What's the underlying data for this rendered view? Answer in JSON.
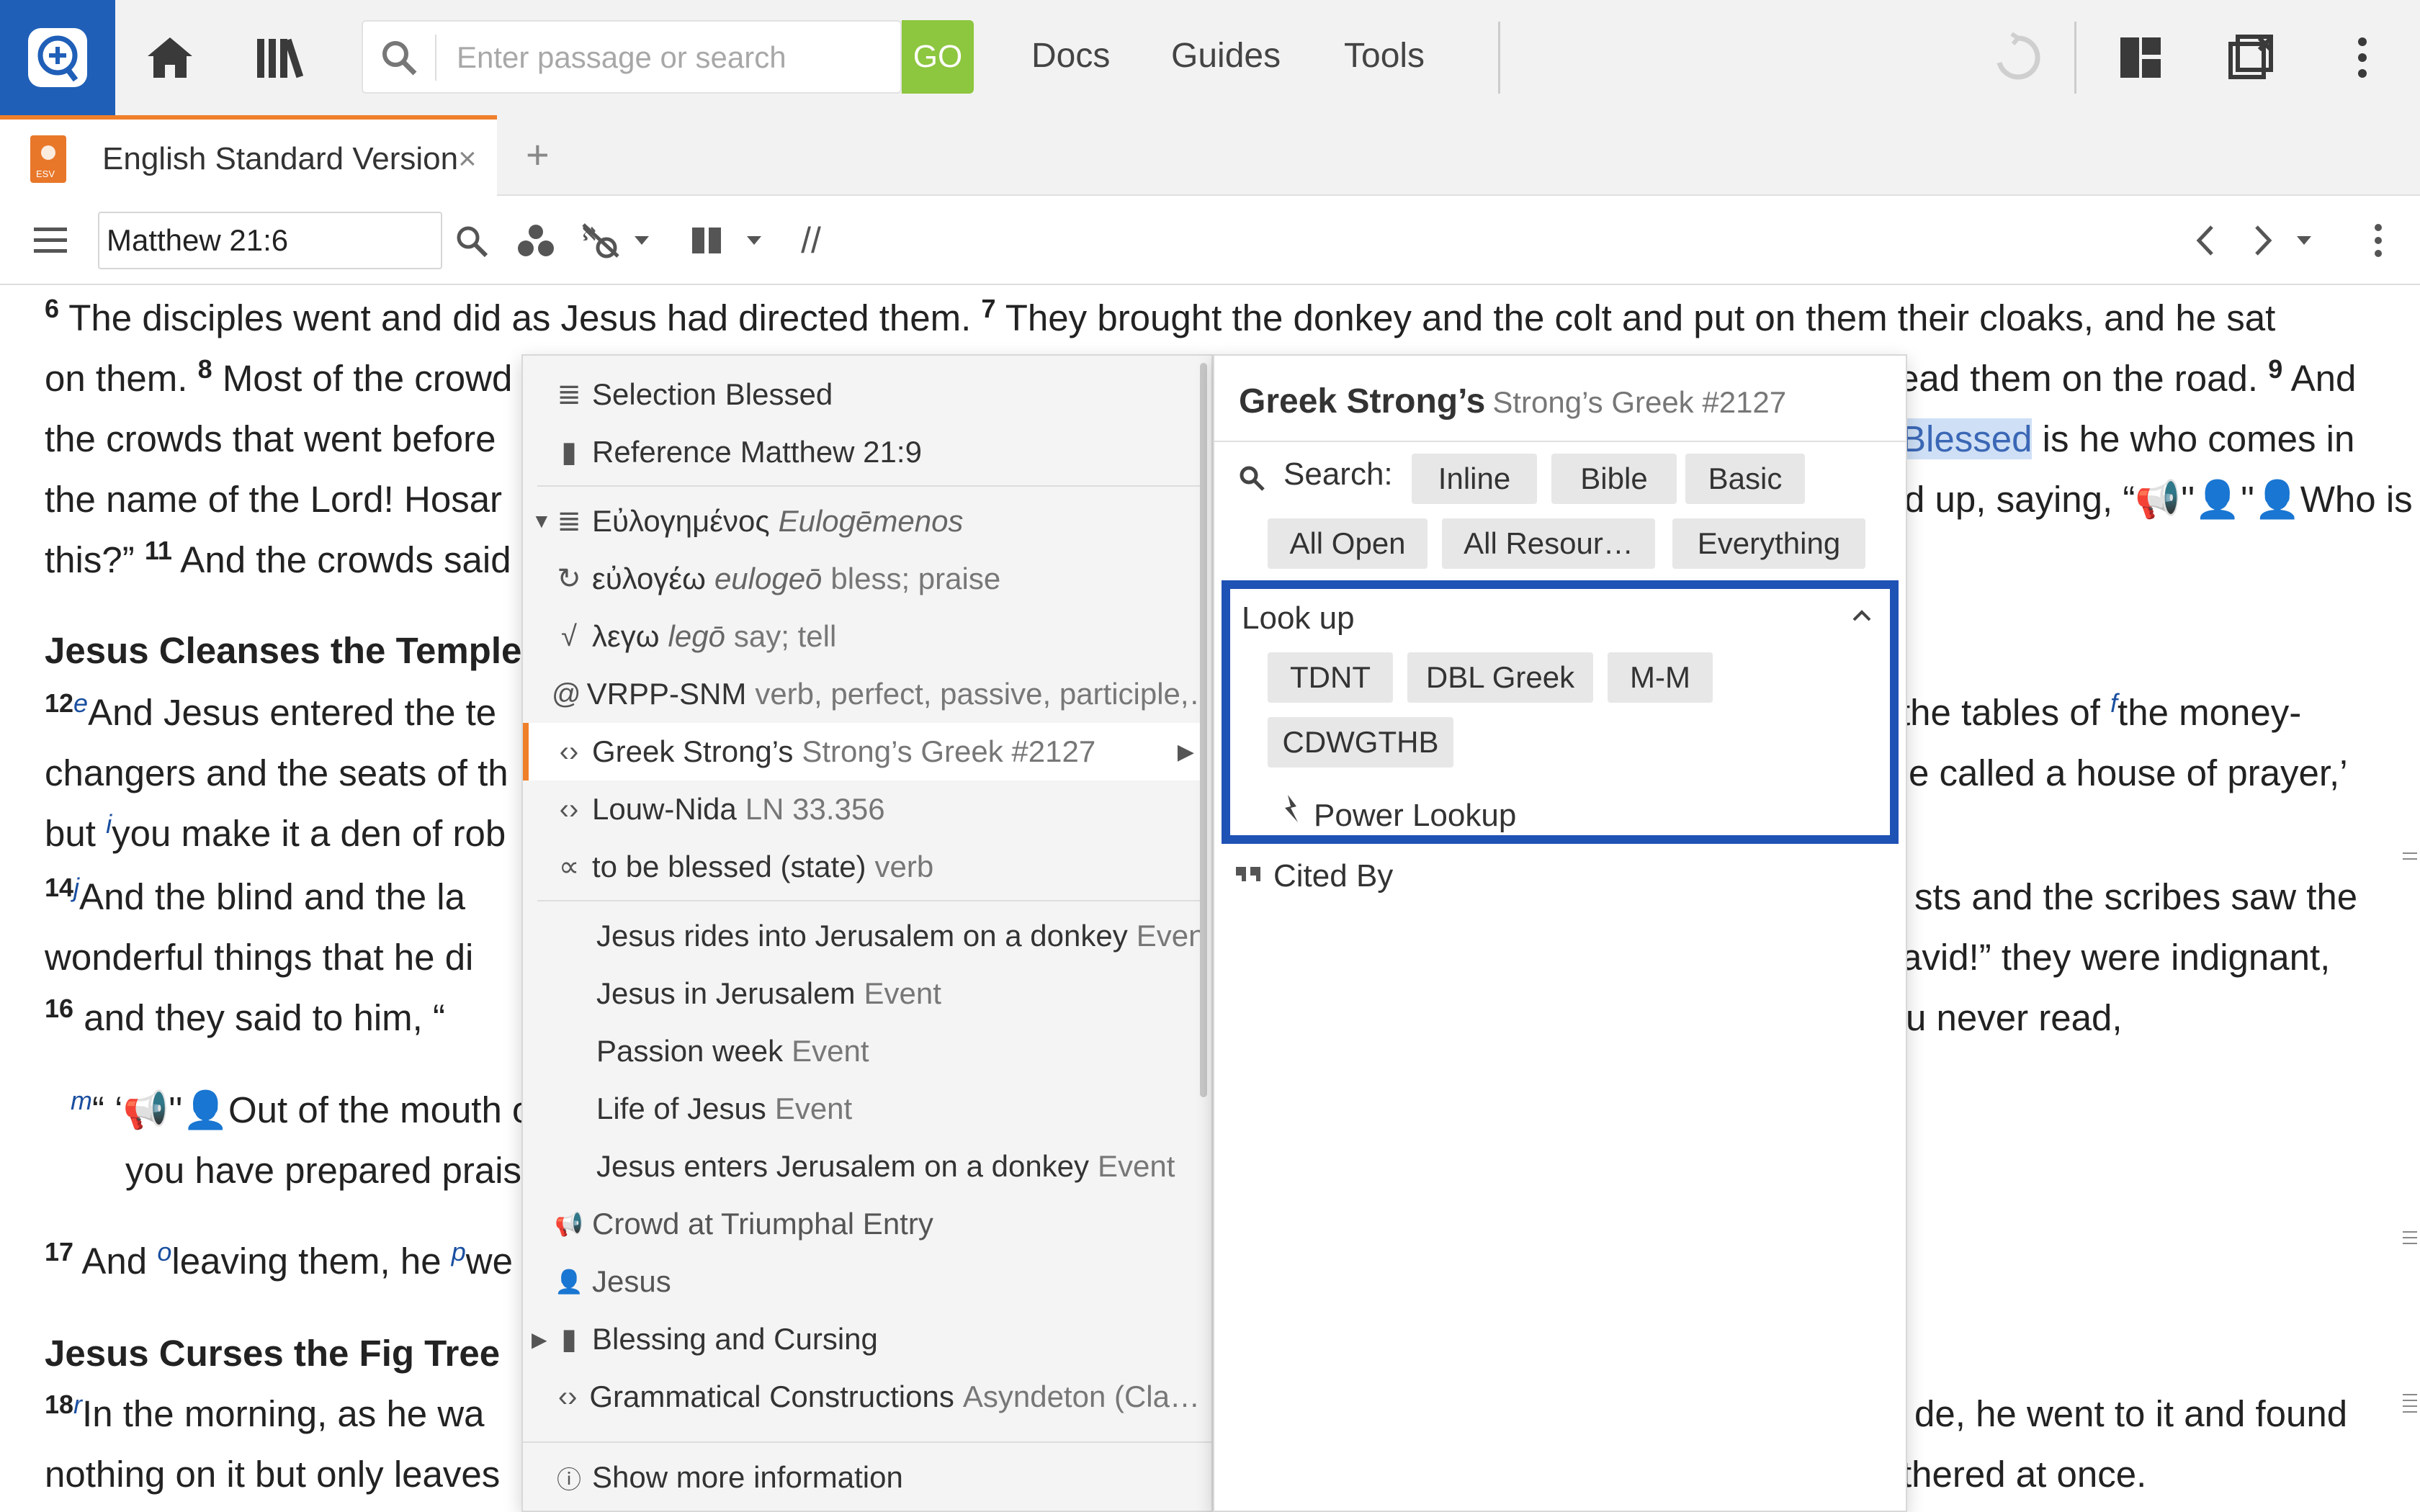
{
  "topbar": {
    "search_placeholder": "Enter passage or search",
    "go_label": "GO",
    "links": [
      "Docs",
      "Guides",
      "Tools"
    ]
  },
  "tab": {
    "title": "English Standard Version",
    "book_badge": "ESV",
    "close_glyph": "×",
    "add_glyph": "+"
  },
  "panel": {
    "reference": "Matthew 21:6",
    "parallel_glyph": "//"
  },
  "bible": {
    "l1": {
      "v6": "6",
      "t1": " The disciples went and did as Jesus had directed them. ",
      "v7": "7",
      "t2": " They brought the donkey and the colt and put on them their cloaks, and he sat"
    },
    "l2": {
      "t1": "on them. ",
      "v8": "8",
      "t2": " Most of the crowd",
      "t3": "ead them on the road. ",
      "v9": "9",
      "t4": " And"
    },
    "l3": {
      "t1": "the crowds that went before",
      "hl": "Blessed",
      "t2": " is he who comes in"
    },
    "l4": {
      "t1": "the name of the Lord! Hosar",
      "t2": "d up, saying, “📢ʹʹ👤ʹʹ👤Who is"
    },
    "l5": {
      "t1": "this?” ",
      "v11": "11",
      "t2": " And the crowds said"
    },
    "h1": "Jesus Cleanses the Temple",
    "l6": {
      "v12": "12",
      "fn": "e",
      "t1": "And Jesus entered the te",
      "t2": " the tables of ",
      "fn2": "f",
      "t3": "the money-"
    },
    "l7": {
      "t1": "changers and the seats of th",
      "t2": "e called a house of prayer,’"
    },
    "l8": {
      "t1": "but ",
      "fn": "i",
      "t2": "you make it a den of rob"
    },
    "l9": {
      "v14": "14",
      "fn": "j",
      "t1": "And the blind and the la",
      "t2": "sts and the scribes saw the"
    },
    "l10": {
      "t1": "wonderful things that he di",
      "t2": "avid!” they were indignant,"
    },
    "l11": {
      "v16": "16",
      "t1": " and they said to him, “",
      "t2": "u never read,"
    },
    "l12": {
      "fn": "m",
      "t1": "“ ‘📢ʹʹ👤Out of the mouth of"
    },
    "l13": {
      "t1": "you have prepared prais"
    },
    "l14": {
      "v17": "17",
      "t1": " And ",
      "fn": "o",
      "t2": "leaving them, he ",
      "fn2": "p",
      "t3": "we"
    },
    "h2": "Jesus Curses the Fig Tree",
    "l15": {
      "v18": "18",
      "fn": "r",
      "t1": "In the morning, as he wa",
      "t2": "de, he went to it and found"
    },
    "l16": {
      "t1": "nothing on it but only leaves",
      "t2": "thered at once."
    }
  },
  "context_menu": {
    "items": [
      {
        "icon": "≣",
        "label": "Selection",
        "sub": "Blessed"
      },
      {
        "icon": "▮",
        "label": "Reference",
        "sub": "Matthew 21:9"
      },
      {
        "icon": "≣",
        "label": "Εὐλογημένος",
        "ital": "Eulogēmenos"
      },
      {
        "icon": "↻",
        "label": "εὐλογέω",
        "ital": "eulogeō",
        "sub": "bless; praise"
      },
      {
        "icon": "√",
        "label": "λεγω",
        "ital": "legō",
        "sub": "say; tell"
      },
      {
        "icon": "@",
        "label": "VRPP-SNM",
        "sub": "verb, perfect, passive, participle,…"
      },
      {
        "icon": "‹›",
        "label": "Greek Strong’s",
        "sub": "Strong’s Greek #2127"
      },
      {
        "icon": "‹›",
        "label": "Louw-Nida",
        "sub": "LN 33.356"
      },
      {
        "icon": "∝",
        "label": "to be blessed (state)",
        "sub": "verb"
      },
      {
        "label": "Jesus rides into Jerusalem on a donkey",
        "sub": "Event"
      },
      {
        "label": "Jesus in Jerusalem",
        "sub": "Event"
      },
      {
        "label": "Passion week",
        "sub": "Event"
      },
      {
        "label": "Life of Jesus",
        "sub": "Event"
      },
      {
        "label": "Jesus enters Jerusalem on a donkey",
        "sub": "Event"
      },
      {
        "icon": "📢",
        "label": "Crowd at Triumphal Entry"
      },
      {
        "icon": "👤",
        "label": "Jesus"
      },
      {
        "icon": "▮",
        "label": "Blessing and Cursing"
      },
      {
        "icon": "‹›",
        "label": "Grammatical Constructions",
        "sub": "Asyndeton (Cla…"
      },
      {
        "icon": "ⓘ",
        "label": "Show more information"
      }
    ]
  },
  "details": {
    "title": "Greek Strong’s",
    "title_sub": "Strong’s Greek #2127",
    "search_label": "Search:",
    "search_chips": [
      "Inline",
      "Bible",
      "Basic",
      "All Open",
      "All Resour…",
      "Everything"
    ],
    "lookup_title": "Look up",
    "lookup_chips": [
      "TDNT",
      "DBL Greek",
      "M-M",
      "CDWGTHB"
    ],
    "power_lookup": "Power Lookup",
    "cited_by": "Cited By"
  }
}
